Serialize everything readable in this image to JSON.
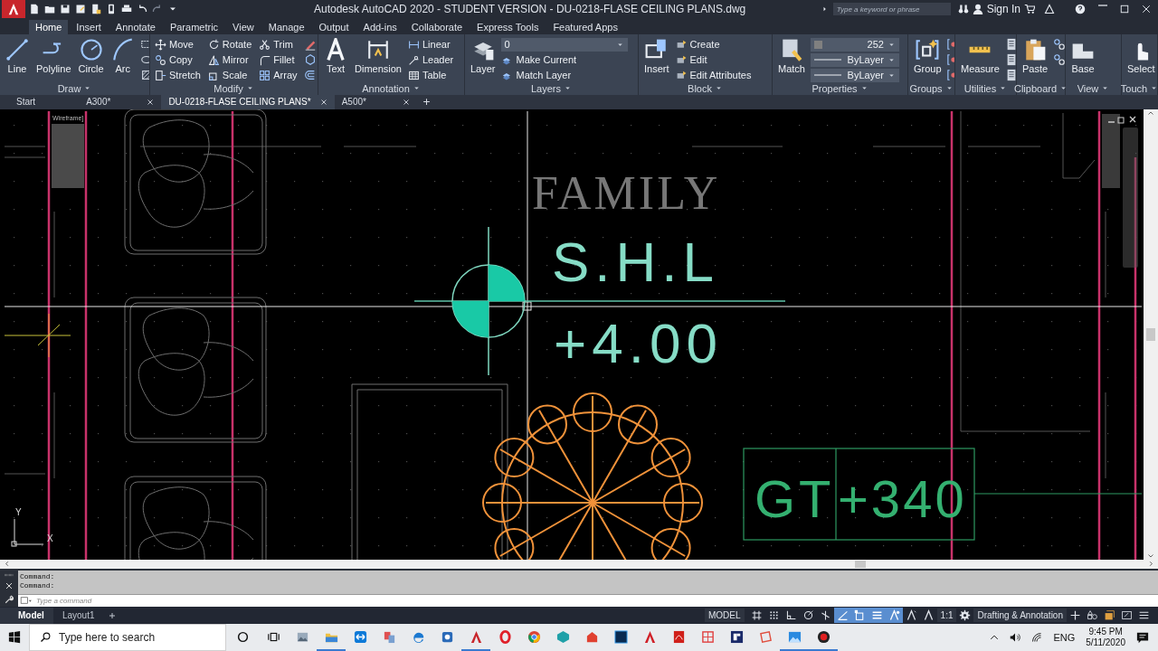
{
  "title_bar": {
    "title": "Autodesk AutoCAD 2020 - STUDENT VERSION - DU-0218-FLASE CEILING PLANS.dwg",
    "search": {
      "placeholder": "Type a keyword or phrase"
    },
    "sign_in": "Sign In"
  },
  "ribbon_tabs": [
    {
      "label": "Home",
      "selected": true
    },
    {
      "label": "Insert",
      "selected": false
    },
    {
      "label": "Annotate",
      "selected": false
    },
    {
      "label": "Parametric",
      "selected": false
    },
    {
      "label": "View",
      "selected": false
    },
    {
      "label": "Manage",
      "selected": false
    },
    {
      "label": "Output",
      "selected": false
    },
    {
      "label": "Add-ins",
      "selected": false
    },
    {
      "label": "Collaborate",
      "selected": false
    },
    {
      "label": "Express Tools",
      "selected": false
    },
    {
      "label": "Featured Apps",
      "selected": false
    }
  ],
  "ribbon_panels": [
    {
      "title": "Draw",
      "tools": [
        {
          "kind": "large",
          "label": "Line"
        },
        {
          "kind": "large",
          "label": "Polyline"
        },
        {
          "kind": "large",
          "label": "Circle"
        },
        {
          "kind": "large",
          "label": "Arc"
        },
        {
          "kind": "icon"
        },
        {
          "kind": "icon"
        },
        {
          "kind": "icon"
        }
      ]
    },
    {
      "title": "Modify",
      "tools": [
        {
          "kind": "small",
          "label": "Move"
        },
        {
          "kind": "small",
          "label": "Copy"
        },
        {
          "kind": "small",
          "label": "Stretch"
        },
        {
          "kind": "small",
          "label": "Rotate"
        },
        {
          "kind": "small",
          "label": "Mirror"
        },
        {
          "kind": "small",
          "label": "Scale"
        },
        {
          "kind": "small",
          "label": "Trim"
        },
        {
          "kind": "small",
          "label": "Fillet"
        },
        {
          "kind": "small",
          "label": "Array"
        },
        {
          "kind": "icon"
        },
        {
          "kind": "icon"
        },
        {
          "kind": "icon"
        }
      ]
    },
    {
      "title": "Annotation",
      "tools": [
        {
          "kind": "large",
          "label": "Text"
        },
        {
          "kind": "large",
          "label": "Dimension"
        },
        {
          "kind": "small",
          "label": "Linear"
        },
        {
          "kind": "small",
          "label": "Leader"
        },
        {
          "kind": "small",
          "label": "Table"
        }
      ]
    },
    {
      "title": "Layers",
      "tools": [
        {
          "kind": "large",
          "label": "Layer"
        },
        {
          "kind": "dropdown",
          "label": "0"
        },
        {
          "kind": "small",
          "label": "Make Current"
        },
        {
          "kind": "small",
          "label": "Match Layer"
        }
      ]
    },
    {
      "title": "Block",
      "tools": [
        {
          "kind": "large",
          "label": "Insert"
        },
        {
          "kind": "small",
          "label": "Create"
        },
        {
          "kind": "small",
          "label": "Edit"
        },
        {
          "kind": "small",
          "label": "Edit Attributes"
        }
      ]
    },
    {
      "title": "Properties",
      "tools": [
        {
          "kind": "large",
          "label": "Match"
        },
        {
          "kind": "dropdown",
          "label": "252"
        },
        {
          "kind": "dropdown",
          "label": "ByLayer"
        },
        {
          "kind": "dropdown",
          "label": "ByLayer"
        }
      ]
    },
    {
      "title": "Groups",
      "tools": [
        {
          "kind": "large",
          "label": "Group"
        },
        {
          "kind": "icon"
        },
        {
          "kind": "icon"
        },
        {
          "kind": "icon"
        }
      ]
    },
    {
      "title": "Utilities",
      "tools": [
        {
          "kind": "large",
          "label": "Measure"
        },
        {
          "kind": "icon"
        },
        {
          "kind": "icon"
        },
        {
          "kind": "icon"
        }
      ]
    },
    {
      "title": "Clipboard",
      "tools": [
        {
          "kind": "large",
          "label": "Paste"
        },
        {
          "kind": "icon"
        },
        {
          "kind": "icon"
        }
      ]
    },
    {
      "title": "View",
      "tools": [
        {
          "kind": "large",
          "label": "Base"
        }
      ]
    },
    {
      "title": "Touch",
      "tools": [
        {
          "kind": "large",
          "label": "Select"
        }
      ]
    }
  ],
  "file_tabs": [
    {
      "label": "Start",
      "selected": false,
      "closable": false
    },
    {
      "label": "A300*",
      "selected": false,
      "closable": true
    },
    {
      "label": "DU-0218-FLASE CEILING PLANS*",
      "selected": true,
      "closable": true
    },
    {
      "label": "A500*",
      "selected": false,
      "closable": true
    }
  ],
  "viewport_label": "Wireframe]",
  "drawing": {
    "room_name": "FAMILY",
    "level_label": "S.H.L",
    "level_value": "+4.00",
    "tag_code": "GT",
    "tag_value": "+340",
    "ucs_y": "Y",
    "ucs_x": "X"
  },
  "command_line": {
    "history": [
      "Command:",
      "Command:"
    ],
    "placeholder": "Type a command"
  },
  "layout_tabs": [
    {
      "label": "Model",
      "selected": true
    },
    {
      "label": "Layout1",
      "selected": false
    }
  ],
  "status_bar": [
    {
      "kind": "label",
      "label": "MODEL"
    },
    {
      "kind": "toggle",
      "on": false
    },
    {
      "kind": "toggle",
      "on": false
    },
    {
      "kind": "toggle",
      "on": false
    },
    {
      "kind": "toggle",
      "on": false
    },
    {
      "kind": "toggle",
      "on": false
    },
    {
      "kind": "toggle",
      "on": true
    },
    {
      "kind": "toggle",
      "on": true
    },
    {
      "kind": "toggle",
      "on": true
    },
    {
      "kind": "toggle",
      "on": true
    },
    {
      "kind": "toggle",
      "on": false
    },
    {
      "kind": "toggle",
      "on": false
    },
    {
      "kind": "label",
      "label": "1:1"
    },
    {
      "kind": "toggle",
      "on": false
    },
    {
      "kind": "label",
      "label": "Drafting & Annotation"
    },
    {
      "kind": "toggle",
      "on": false
    },
    {
      "kind": "toggle",
      "on": false
    },
    {
      "kind": "toggle",
      "on": false
    },
    {
      "kind": "toggle",
      "on": false
    },
    {
      "kind": "toggle",
      "on": false
    }
  ],
  "taskbar": {
    "search": {
      "placeholder": "Type here to search"
    },
    "apps": [
      {
        "running": false
      },
      {
        "running": true
      },
      {
        "running": false
      },
      {
        "running": false
      },
      {
        "running": false
      },
      {
        "running": false
      },
      {
        "running": true
      },
      {
        "running": false
      },
      {
        "running": false
      },
      {
        "running": false
      },
      {
        "running": false
      },
      {
        "running": false
      },
      {
        "running": false
      },
      {
        "running": false
      },
      {
        "running": false
      },
      {
        "running": false
      },
      {
        "running": false
      },
      {
        "running": true
      },
      {
        "running": true
      }
    ],
    "language": "ENG",
    "time": "9:45 PM",
    "date": "5/11/2020"
  }
}
